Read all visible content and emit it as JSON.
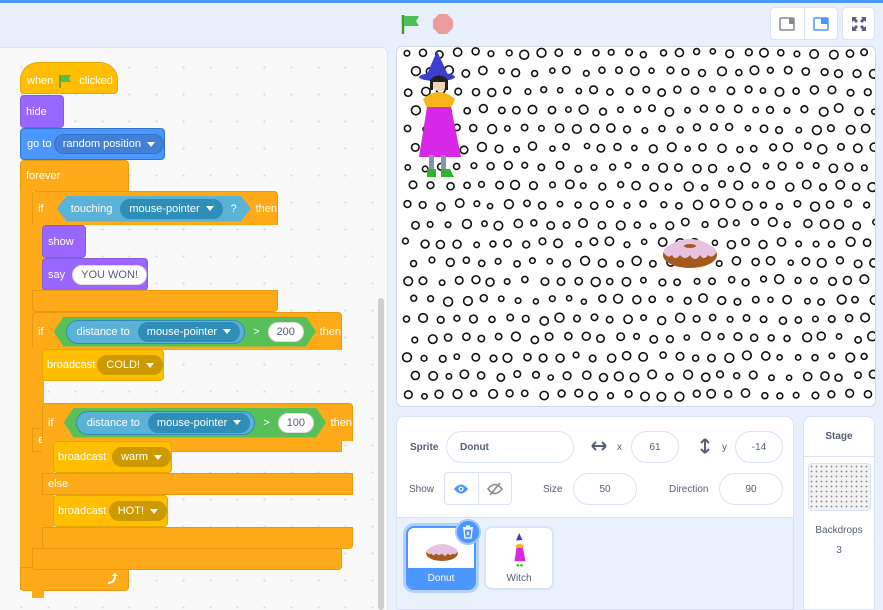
{
  "header": {
    "green_flag": "green-flag",
    "stop": "stop-sign",
    "view_modes": [
      "small-stage-mode",
      "normal-stage-mode"
    ],
    "fullscreen": "fullscreen"
  },
  "script": {
    "hat": {
      "when": "when",
      "clicked": "clicked"
    },
    "hide": "hide",
    "goto": {
      "label": "go to",
      "target": "random position"
    },
    "forever": "forever",
    "if1": {
      "if": "if",
      "sensor": "touching",
      "object": "mouse-pointer",
      "q": "?",
      "then": "then"
    },
    "show": "show",
    "say": {
      "label": "say",
      "text": "YOU WON!"
    },
    "if2": {
      "if": "if",
      "reporter": "distance to",
      "object": "mouse-pointer",
      "op": ">",
      "value": "200",
      "then": "then"
    },
    "broadcast_cold": {
      "label": "broadcast",
      "message": "COLD!"
    },
    "else1": "else",
    "if3": {
      "if": "if",
      "reporter": "distance to",
      "object": "mouse-pointer",
      "op": ">",
      "value": "100",
      "then": "then"
    },
    "broadcast_warm": {
      "label": "broadcast",
      "message": "warm"
    },
    "else2": "else",
    "broadcast_hot": {
      "label": "broadcast",
      "message": "HOT!"
    }
  },
  "sprite_info": {
    "sprite_label": "Sprite",
    "sprite_name": "Donut",
    "x_label": "x",
    "x_value": "61",
    "y_label": "y",
    "y_value": "-14",
    "show_label": "Show",
    "size_label": "Size",
    "size_value": "50",
    "direction_label": "Direction",
    "direction_value": "90"
  },
  "sprites": [
    {
      "name": "Donut",
      "selected": true
    },
    {
      "name": "Witch",
      "selected": false
    }
  ],
  "stage_pane": {
    "title": "Stage",
    "backdrops_label": "Backdrops",
    "backdrops_count": "3"
  }
}
